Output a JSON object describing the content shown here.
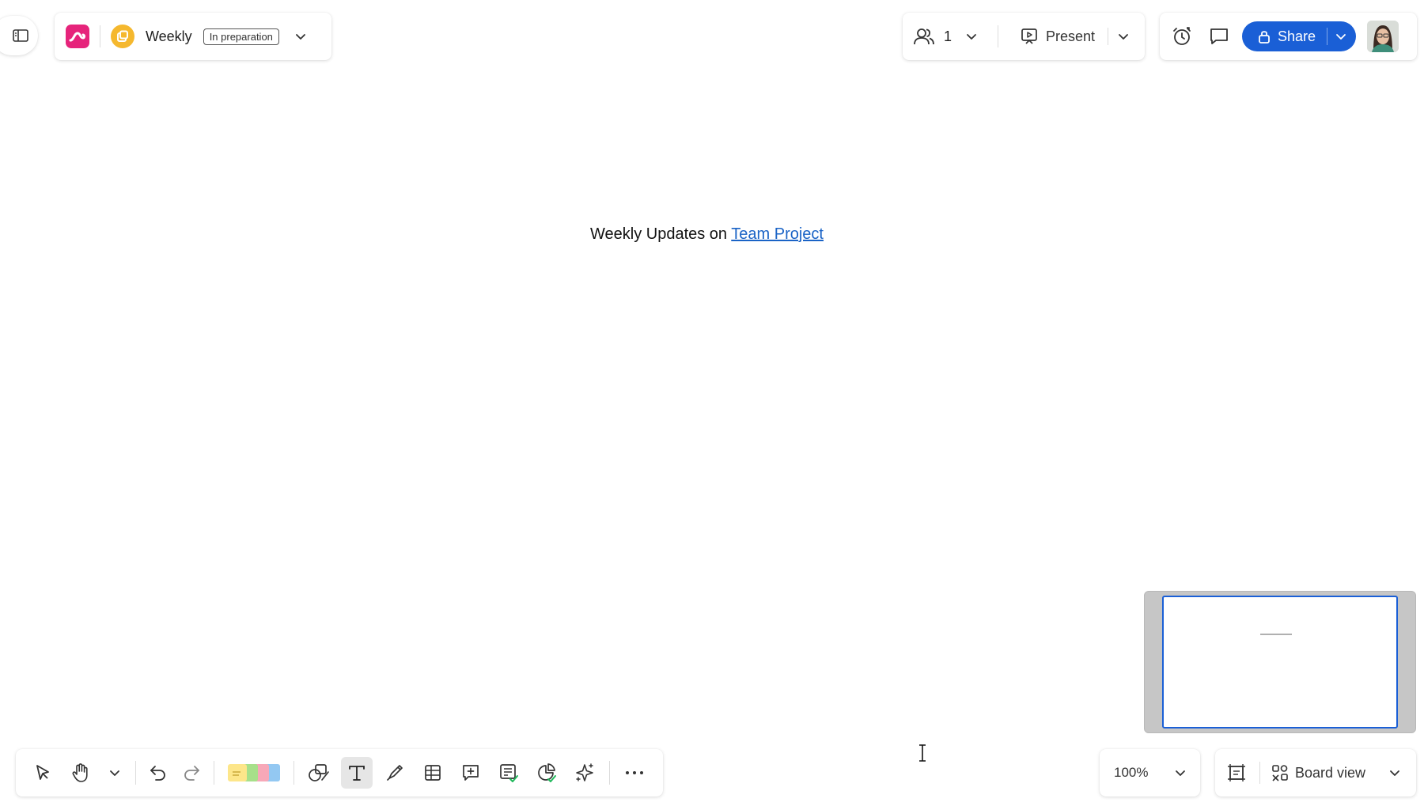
{
  "left_nav": {
    "toggle_icon": "sidebar-toggle-icon"
  },
  "board": {
    "app_icon": "miro-logo-icon",
    "board_icon": "board-icon",
    "title": "Weekly",
    "status": "In preparation"
  },
  "collab": {
    "users_icon": "users-icon",
    "user_count": "1",
    "present_icon": "present-icon",
    "present_label": "Present"
  },
  "actions": {
    "timer_icon": "timer-icon",
    "comments_icon": "comments-icon",
    "share_label": "Share",
    "lock_icon": "lock-icon"
  },
  "canvas": {
    "text_prefix": "Weekly Updates on ",
    "link_text": "Team Project"
  },
  "toolbar": {
    "tools": [
      "select-icon",
      "hand-icon",
      "more-tools-chevron-icon",
      "undo-icon",
      "redo-icon",
      "sticky-notes-icon",
      "shapes-icon",
      "text-icon",
      "pen-icon",
      "table-icon",
      "comment-add-icon",
      "card-icon",
      "chart-icon",
      "ai-sparkle-icon",
      "more-icon"
    ],
    "active_tool": "text-icon",
    "sticky_colors": [
      "#fde68a",
      "#a7e08a",
      "#f7a8b8",
      "#93c8f2"
    ]
  },
  "zoom": {
    "value": "100%"
  },
  "view": {
    "frames_icon": "frames-icon",
    "view_icon": "board-view-icon",
    "label": "Board view"
  },
  "colors": {
    "accent": "#1a5fd6",
    "app_logo": "#e6247b",
    "board_icon": "#f5b82e",
    "link": "#1a63c6"
  }
}
